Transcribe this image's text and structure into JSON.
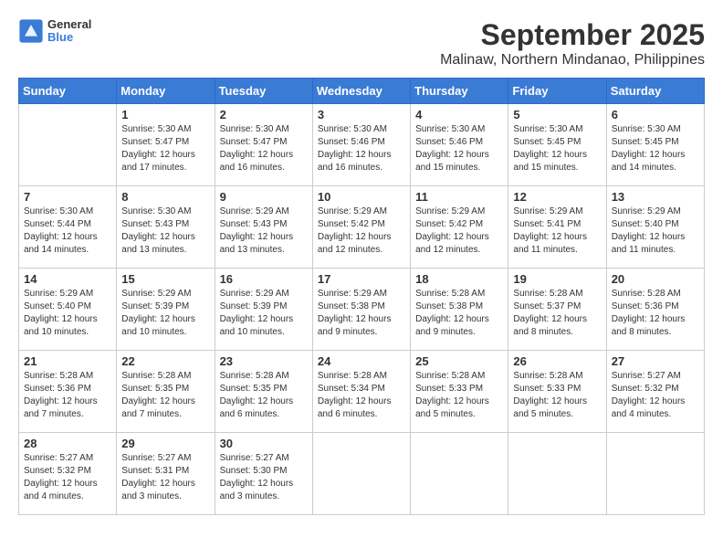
{
  "header": {
    "logo": {
      "line1": "General",
      "line2": "Blue"
    },
    "title": "September 2025",
    "subtitle": "Malinaw, Northern Mindanao, Philippines"
  },
  "days_of_week": [
    "Sunday",
    "Monday",
    "Tuesday",
    "Wednesday",
    "Thursday",
    "Friday",
    "Saturday"
  ],
  "weeks": [
    [
      {
        "day": "",
        "sunrise": "",
        "sunset": "",
        "daylight": ""
      },
      {
        "day": "1",
        "sunrise": "Sunrise: 5:30 AM",
        "sunset": "Sunset: 5:47 PM",
        "daylight": "Daylight: 12 hours and 17 minutes."
      },
      {
        "day": "2",
        "sunrise": "Sunrise: 5:30 AM",
        "sunset": "Sunset: 5:47 PM",
        "daylight": "Daylight: 12 hours and 16 minutes."
      },
      {
        "day": "3",
        "sunrise": "Sunrise: 5:30 AM",
        "sunset": "Sunset: 5:46 PM",
        "daylight": "Daylight: 12 hours and 16 minutes."
      },
      {
        "day": "4",
        "sunrise": "Sunrise: 5:30 AM",
        "sunset": "Sunset: 5:46 PM",
        "daylight": "Daylight: 12 hours and 15 minutes."
      },
      {
        "day": "5",
        "sunrise": "Sunrise: 5:30 AM",
        "sunset": "Sunset: 5:45 PM",
        "daylight": "Daylight: 12 hours and 15 minutes."
      },
      {
        "day": "6",
        "sunrise": "Sunrise: 5:30 AM",
        "sunset": "Sunset: 5:45 PM",
        "daylight": "Daylight: 12 hours and 14 minutes."
      }
    ],
    [
      {
        "day": "7",
        "sunrise": "Sunrise: 5:30 AM",
        "sunset": "Sunset: 5:44 PM",
        "daylight": "Daylight: 12 hours and 14 minutes."
      },
      {
        "day": "8",
        "sunrise": "Sunrise: 5:30 AM",
        "sunset": "Sunset: 5:43 PM",
        "daylight": "Daylight: 12 hours and 13 minutes."
      },
      {
        "day": "9",
        "sunrise": "Sunrise: 5:29 AM",
        "sunset": "Sunset: 5:43 PM",
        "daylight": "Daylight: 12 hours and 13 minutes."
      },
      {
        "day": "10",
        "sunrise": "Sunrise: 5:29 AM",
        "sunset": "Sunset: 5:42 PM",
        "daylight": "Daylight: 12 hours and 12 minutes."
      },
      {
        "day": "11",
        "sunrise": "Sunrise: 5:29 AM",
        "sunset": "Sunset: 5:42 PM",
        "daylight": "Daylight: 12 hours and 12 minutes."
      },
      {
        "day": "12",
        "sunrise": "Sunrise: 5:29 AM",
        "sunset": "Sunset: 5:41 PM",
        "daylight": "Daylight: 12 hours and 11 minutes."
      },
      {
        "day": "13",
        "sunrise": "Sunrise: 5:29 AM",
        "sunset": "Sunset: 5:40 PM",
        "daylight": "Daylight: 12 hours and 11 minutes."
      }
    ],
    [
      {
        "day": "14",
        "sunrise": "Sunrise: 5:29 AM",
        "sunset": "Sunset: 5:40 PM",
        "daylight": "Daylight: 12 hours and 10 minutes."
      },
      {
        "day": "15",
        "sunrise": "Sunrise: 5:29 AM",
        "sunset": "Sunset: 5:39 PM",
        "daylight": "Daylight: 12 hours and 10 minutes."
      },
      {
        "day": "16",
        "sunrise": "Sunrise: 5:29 AM",
        "sunset": "Sunset: 5:39 PM",
        "daylight": "Daylight: 12 hours and 10 minutes."
      },
      {
        "day": "17",
        "sunrise": "Sunrise: 5:29 AM",
        "sunset": "Sunset: 5:38 PM",
        "daylight": "Daylight: 12 hours and 9 minutes."
      },
      {
        "day": "18",
        "sunrise": "Sunrise: 5:28 AM",
        "sunset": "Sunset: 5:38 PM",
        "daylight": "Daylight: 12 hours and 9 minutes."
      },
      {
        "day": "19",
        "sunrise": "Sunrise: 5:28 AM",
        "sunset": "Sunset: 5:37 PM",
        "daylight": "Daylight: 12 hours and 8 minutes."
      },
      {
        "day": "20",
        "sunrise": "Sunrise: 5:28 AM",
        "sunset": "Sunset: 5:36 PM",
        "daylight": "Daylight: 12 hours and 8 minutes."
      }
    ],
    [
      {
        "day": "21",
        "sunrise": "Sunrise: 5:28 AM",
        "sunset": "Sunset: 5:36 PM",
        "daylight": "Daylight: 12 hours and 7 minutes."
      },
      {
        "day": "22",
        "sunrise": "Sunrise: 5:28 AM",
        "sunset": "Sunset: 5:35 PM",
        "daylight": "Daylight: 12 hours and 7 minutes."
      },
      {
        "day": "23",
        "sunrise": "Sunrise: 5:28 AM",
        "sunset": "Sunset: 5:35 PM",
        "daylight": "Daylight: 12 hours and 6 minutes."
      },
      {
        "day": "24",
        "sunrise": "Sunrise: 5:28 AM",
        "sunset": "Sunset: 5:34 PM",
        "daylight": "Daylight: 12 hours and 6 minutes."
      },
      {
        "day": "25",
        "sunrise": "Sunrise: 5:28 AM",
        "sunset": "Sunset: 5:33 PM",
        "daylight": "Daylight: 12 hours and 5 minutes."
      },
      {
        "day": "26",
        "sunrise": "Sunrise: 5:28 AM",
        "sunset": "Sunset: 5:33 PM",
        "daylight": "Daylight: 12 hours and 5 minutes."
      },
      {
        "day": "27",
        "sunrise": "Sunrise: 5:27 AM",
        "sunset": "Sunset: 5:32 PM",
        "daylight": "Daylight: 12 hours and 4 minutes."
      }
    ],
    [
      {
        "day": "28",
        "sunrise": "Sunrise: 5:27 AM",
        "sunset": "Sunset: 5:32 PM",
        "daylight": "Daylight: 12 hours and 4 minutes."
      },
      {
        "day": "29",
        "sunrise": "Sunrise: 5:27 AM",
        "sunset": "Sunset: 5:31 PM",
        "daylight": "Daylight: 12 hours and 3 minutes."
      },
      {
        "day": "30",
        "sunrise": "Sunrise: 5:27 AM",
        "sunset": "Sunset: 5:30 PM",
        "daylight": "Daylight: 12 hours and 3 minutes."
      },
      {
        "day": "",
        "sunrise": "",
        "sunset": "",
        "daylight": ""
      },
      {
        "day": "",
        "sunrise": "",
        "sunset": "",
        "daylight": ""
      },
      {
        "day": "",
        "sunrise": "",
        "sunset": "",
        "daylight": ""
      },
      {
        "day": "",
        "sunrise": "",
        "sunset": "",
        "daylight": ""
      }
    ]
  ]
}
